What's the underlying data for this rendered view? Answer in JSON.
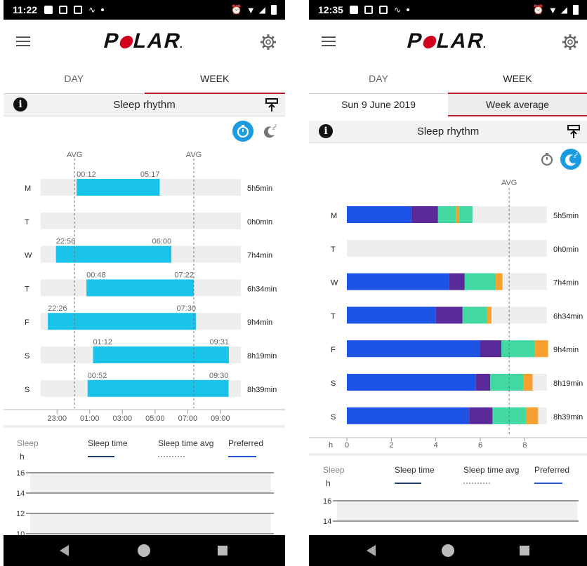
{
  "colors": {
    "accent_red": "#c0162c",
    "bar_cyan": "#19c3ea",
    "toggle_blue": "#1b9be0",
    "deep_sleep": "#1e54e6",
    "rem_sleep": "#5b2a99",
    "light_sleep": "#41d8a1",
    "awake": "#f6a02d",
    "track": "#eeeeee"
  },
  "left": {
    "status_time": "11:22",
    "logo": [
      "P",
      "L",
      "A",
      "R",
      "."
    ],
    "tabs": {
      "day": "DAY",
      "week": "WEEK"
    },
    "rhythm_title": "Sleep rhythm",
    "avg_label": "AVG",
    "days": [
      {
        "day": "M",
        "start_label": "00:12",
        "end_label": "05:17",
        "start": 0.2,
        "end": 5.283,
        "duration": "5h5min"
      },
      {
        "day": "T",
        "start_label": "",
        "end_label": "",
        "start": null,
        "end": null,
        "duration": "0h0min"
      },
      {
        "day": "W",
        "start_label": "22:56",
        "end_label": "06:00",
        "start": -1.067,
        "end": 6.0,
        "duration": "7h4min"
      },
      {
        "day": "T",
        "start_label": "00:48",
        "end_label": "07:22",
        "start": 0.8,
        "end": 7.367,
        "duration": "6h34min"
      },
      {
        "day": "F",
        "start_label": "22:26",
        "end_label": "07:30",
        "start": -1.567,
        "end": 7.5,
        "duration": "9h4min"
      },
      {
        "day": "S",
        "start_label": "01:12",
        "end_label": "09:31",
        "start": 1.2,
        "end": 9.517,
        "duration": "8h19min"
      },
      {
        "day": "S",
        "start_label": "00:52",
        "end_label": "09:30",
        "start": 0.867,
        "end": 9.5,
        "duration": "8h39min"
      }
    ],
    "x_range": [
      -2,
      10.25
    ],
    "avg_start": 0.2,
    "avg_end": 7.5,
    "x_ticks": [
      {
        "label": "23:00",
        "v": -1
      },
      {
        "label": "01:00",
        "v": 1
      },
      {
        "label": "03:00",
        "v": 3
      },
      {
        "label": "05:00",
        "v": 5
      },
      {
        "label": "07:00",
        "v": 7
      },
      {
        "label": "09:00",
        "v": 9
      }
    ],
    "legend": {
      "sleep": "Sleep",
      "unit": "h",
      "sleep_time": "Sleep time",
      "sleep_time_avg": "Sleep time avg",
      "preferred": "Preferred"
    },
    "y_ticks": [
      "16",
      "14",
      "12",
      "10"
    ]
  },
  "right": {
    "status_time": "12:35",
    "logo": [
      "P",
      "L",
      "A",
      "R",
      "."
    ],
    "tabs": {
      "day": "DAY",
      "week": "WEEK"
    },
    "subtabs": {
      "date": "Sun 9 June 2019",
      "average": "Week average"
    },
    "rhythm_title": "Sleep rhythm",
    "avg_label": "AVG",
    "x_unit": "h",
    "x_range": [
      0,
      9
    ],
    "avg_value": 7.3,
    "x_ticks": [
      {
        "label": "0",
        "v": 0
      },
      {
        "label": "2",
        "v": 2
      },
      {
        "label": "4",
        "v": 4
      },
      {
        "label": "6",
        "v": 6
      },
      {
        "label": "8",
        "v": 8
      }
    ],
    "days": [
      {
        "day": "M",
        "duration": "5h5min",
        "segments": [
          2.9,
          1.2,
          0.8,
          0.15,
          0.6
        ]
      },
      {
        "day": "T",
        "duration": "0h0min",
        "segments": []
      },
      {
        "day": "W",
        "duration": "7h4min",
        "segments": [
          4.6,
          0.7,
          1.4,
          0.3
        ]
      },
      {
        "day": "T",
        "duration": "6h34min",
        "segments": [
          4.0,
          1.2,
          1.1,
          0.2
        ]
      },
      {
        "day": "F",
        "duration": "9h4min",
        "segments": [
          6.0,
          0.95,
          1.5,
          0.6
        ]
      },
      {
        "day": "S",
        "duration": "8h19min",
        "segments": [
          5.8,
          0.65,
          1.5,
          0.4
        ]
      },
      {
        "day": "S",
        "duration": "8h39min",
        "segments": [
          5.5,
          1.05,
          1.5,
          0.55
        ]
      }
    ],
    "segment_colors": [
      "#1e54e6",
      "#5b2a99",
      "#41d8a1",
      "#f6a02d",
      "#41d8a1"
    ],
    "legend": {
      "sleep": "Sleep",
      "unit": "h",
      "sleep_time": "Sleep time",
      "sleep_time_avg": "Sleep time avg",
      "preferred": "Preferred"
    },
    "y_ticks": [
      "16",
      "14"
    ]
  }
}
